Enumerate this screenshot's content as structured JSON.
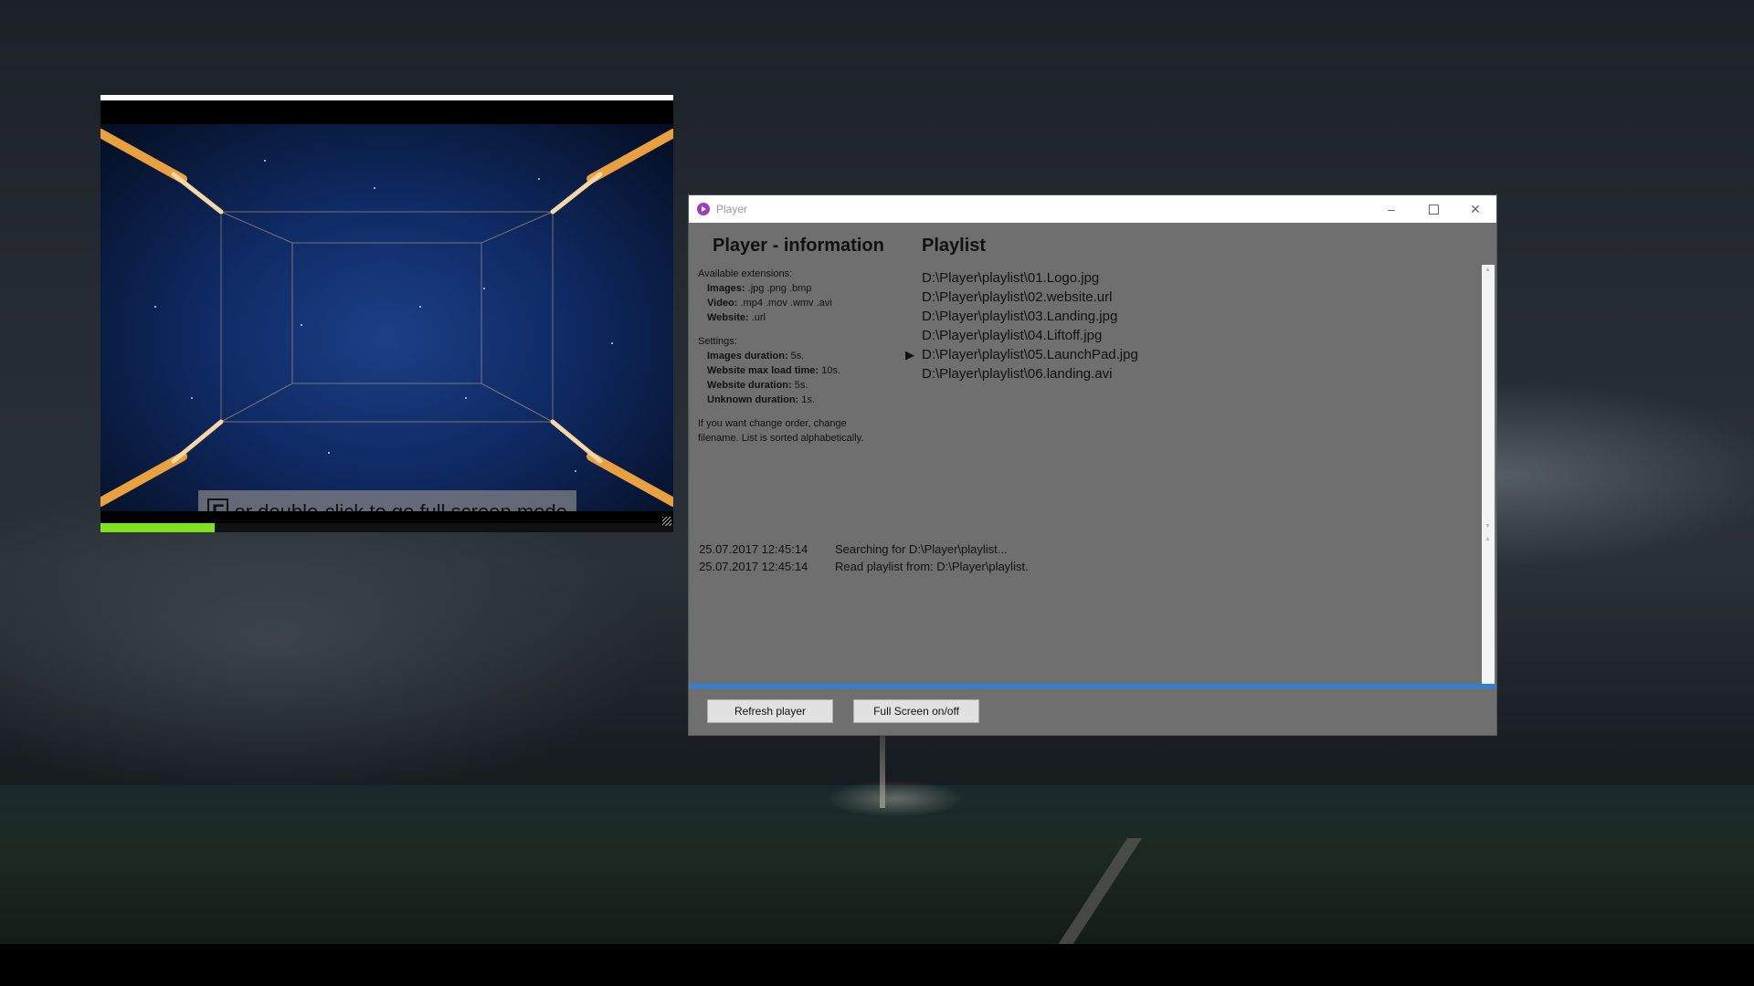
{
  "window": {
    "title": "Player",
    "controls": {
      "minimize": "–",
      "close": "✕"
    }
  },
  "info": {
    "heading": "Player - information",
    "extensions_label": "Available extensions:",
    "extensions": [
      {
        "name": "Images:",
        "value": " .jpg .png .bmp"
      },
      {
        "name": "Video:",
        "value": " .mp4 .mov .wmv .avi"
      },
      {
        "name": "Website:",
        "value": " .url"
      }
    ],
    "settings_label": "Settings:",
    "settings": [
      {
        "name": "Images duration:",
        "value": " 5s."
      },
      {
        "name": "Website max load time:",
        "value": " 10s."
      },
      {
        "name": "Website duration:",
        "value": " 5s."
      },
      {
        "name": "Unknown duration:",
        "value": " 1s."
      }
    ],
    "note": "If you want change order, change filename. List is sorted alphabetically."
  },
  "playlist": {
    "heading": "Playlist",
    "current_marker": "▶",
    "items": [
      "D:\\Player\\playlist\\01.Logo.jpg",
      "D:\\Player\\playlist\\02.website.url",
      "D:\\Player\\playlist\\03.Landing.jpg",
      "D:\\Player\\playlist\\04.Liftoff.jpg",
      "D:\\Player\\playlist\\05.LaunchPad.jpg",
      "D:\\Player\\playlist\\06.landing.avi"
    ]
  },
  "log": [
    {
      "time": "25.07.2017 12:45:14",
      "message": "Searching for D:\\Player\\playlist..."
    },
    {
      "time": "25.07.2017 12:45:14",
      "message": "Read playlist from: D:\\Player\\playlist."
    }
  ],
  "buttons": {
    "refresh": "Refresh player",
    "fullscreen": "Full Screen on/off"
  },
  "preview": {
    "hint_key": "F",
    "hint_text": "or double-click to go full screen mode",
    "progress_fraction": 0.2
  },
  "colors": {
    "progress": "#7ee21e",
    "accent_bar": "#2f7fd6",
    "app_icon": "#9b3fbf",
    "window_bg": "#6f6f6f"
  }
}
